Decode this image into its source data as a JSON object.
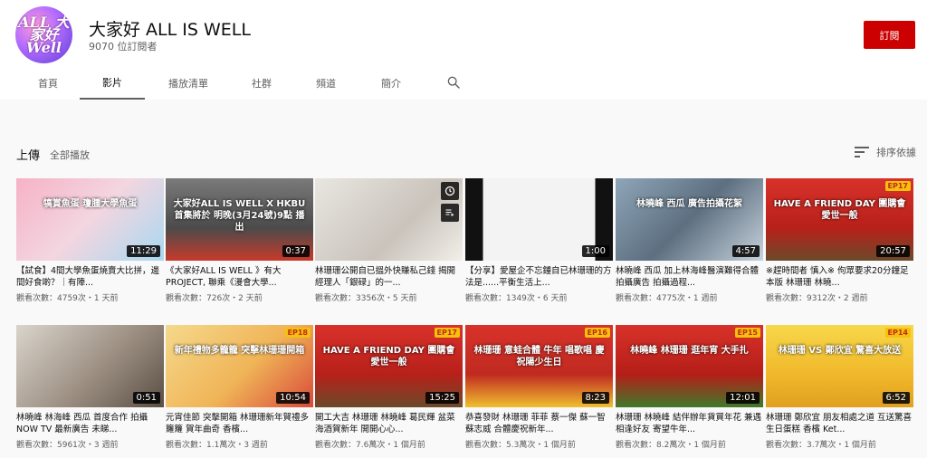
{
  "channel": {
    "avatar_text": "ALL 大家好 Well",
    "name": "大家好 ALL IS WELL",
    "subscribers": "9070 位訂閱者",
    "subscribe_label": "訂閱",
    "brand_color": "#cc0000"
  },
  "tabs": [
    {
      "label": "首頁"
    },
    {
      "label": "影片"
    },
    {
      "label": "播放清單"
    },
    {
      "label": "社群"
    },
    {
      "label": "頻道"
    },
    {
      "label": "簡介"
    }
  ],
  "search_icon": "search-icon",
  "section": {
    "title": "上傳",
    "play_all": "全部播放",
    "sort_label": "排序依據"
  },
  "videos": [
    {
      "thumb_text": "犒賞魚蛋 瓊腫大學魚蛋",
      "duration": "11:29",
      "title": "【試食】4間大學魚蛋燒賣大比拼，邊間好食啲？｜有陣...",
      "meta": "觀看次數：4759次・1 天前",
      "bg": "linear-gradient(135deg,#f6b2c7,#f3d6e0 50%,#a8d8f0)"
    },
    {
      "thumb_text": "大家好ALL IS WELL X HKBU 首集將於 明晚(3月24號)9點 播出",
      "duration": "0:37",
      "title": "《大家好ALL IS WELL 》有大 PROJECT, 聯乘《漫會大學...",
      "meta": "觀看次數：726次・2 天前",
      "bg": "linear-gradient(180deg,#7a7a7a,#4b4b4b 60%,#c73a2b)"
    },
    {
      "thumb_text": "",
      "duration": "",
      "title": "林珊珊公開自已搵外快賺私己錢 揭開經理人「銀碌」的一...",
      "meta": "觀看次數：3356次・5 天前",
      "bg": "linear-gradient(135deg,#e9e6e1,#c9c3bb 60%,#f2efe9)"
    },
    {
      "thumb_text": "",
      "duration": "1:00",
      "title": "【分享】愛屋企不忘鍾自已林珊珊的方法是......平衡生活上...",
      "meta": "觀看次數：1349次・6 天前",
      "bg": "linear-gradient(90deg,#111 0%,#111 12%,#f3f3f3 12%,#f3f3f3 88%,#111 88%)"
    },
    {
      "thumb_text": "林曉峰 西瓜 廣告拍攝花絮",
      "duration": "4:57",
      "title": "林曉峰 西瓜 加上林海峰醫演難得合體拍攝廣告 拍攝過程...",
      "meta": "觀看次數：4775次・1 週前",
      "bg": "linear-gradient(135deg,#8ea6b8,#5d6f80 50%,#c7d3dc)"
    },
    {
      "thumb_text": "HAVE A FRIEND DAY 團購會愛世一般",
      "duration": "20:57",
      "ep": "EP17",
      "title": "※趕時間者 慎入※ 佝眾要求20分鐘足本版 林珊珊 林曉...",
      "meta": "觀看次數：9312次・2 週前",
      "bg": "linear-gradient(180deg,#d8322a,#b8201a 60%,#6b4a2a)"
    },
    {
      "thumb_text": "",
      "duration": "0:51",
      "title": "林曉峰 林海峰 西瓜 首度合作 拍攝 NOW TV 最新廣告 未睇...",
      "meta": "觀看次數：5961次・3 週前",
      "bg": "linear-gradient(135deg,#d9d4cc,#9c8f82 55%,#5a4e44)"
    },
    {
      "thumb_text": "新年禮物多籠籠 突擊林珊珊開箱",
      "duration": "10:54",
      "ep": "EP18",
      "title": "元宵佳節 突擊開箱 林珊珊新年賀禮多籮籮 賀年曲奇 香檳...",
      "meta": "觀看次數：1.1萬次・3 週前",
      "bg": "linear-gradient(135deg,#f5d98b,#f0b457 55%,#d94a3a)"
    },
    {
      "thumb_text": "HAVE A FRIEND DAY 團購會愛世一般",
      "duration": "15:25",
      "ep": "EP17",
      "title": "開工大吉 林珊珊 林曉峰 葛民輝 盆菜海酒賀新年 開開心心...",
      "meta": "觀看次數：7.6萬次・1 個月前",
      "bg": "linear-gradient(180deg,#d8322a,#b8201a 60%,#6b4a2a)"
    },
    {
      "thumb_text": "林珊珊 意蛙合體 牛年 唱歌唱 慶祝陽少生日",
      "duration": "8:23",
      "ep": "EP16",
      "title": "恭喜發財 林珊珊 菲菲 蔡一傑 蘇一智 蘇志威 合體慶祝新年...",
      "meta": "觀看次數：5.3萬次・1 個月前",
      "bg": "linear-gradient(180deg,#d8322a,#c02a20 60%,#f0c030)"
    },
    {
      "thumb_text": "林曉峰 林珊珊 逛年宵 大手扎",
      "duration": "12:01",
      "ep": "EP15",
      "title": "林珊珊 林曉峰 結伴辦年貨買年花 兼遇相逢好友 寄望牛年...",
      "meta": "觀看次數：8.2萬次・1 個月前",
      "bg": "linear-gradient(180deg,#d8322a,#b51e18 60%,#3f7a2a)"
    },
    {
      "thumb_text": "林珊珊 VS 鄭欣宜 驚喜大放送",
      "duration": "6:52",
      "ep": "EP14",
      "title": "林珊珊 鄭欣宜 朋友相處之道 互送驚喜 生日蛋糕 香檳 Ket...",
      "meta": "觀看次數：3.7萬次・1 個月前",
      "bg": "linear-gradient(180deg,#f7d84a,#f0b82a 60%,#e0a020)"
    }
  ],
  "colors": {
    "progress": "#ff0000",
    "ep_badge_bg": "#f4c20d"
  }
}
